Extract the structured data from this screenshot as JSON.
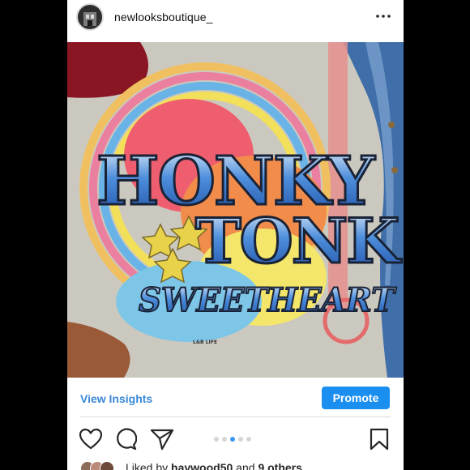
{
  "post": {
    "username": "newlooksboutique_",
    "more_icon": "more-options-icon",
    "image": {
      "headline_1": "HONKY",
      "headline_2": "TONK",
      "headline_3": "SWEETHEART",
      "brand_tag": "L&B LIFE"
    },
    "insights_label": "View Insights",
    "promote_label": "Promote",
    "carousel": {
      "count": 5,
      "active_index": 3
    },
    "actions": {
      "like_icon": "heart-icon",
      "comment_icon": "comment-icon",
      "share_icon": "send-icon",
      "save_icon": "bookmark-icon"
    },
    "liked_by": {
      "prefix": "Liked by ",
      "user": "haywood50",
      "middle": " and ",
      "others": "9 others"
    }
  },
  "colors": {
    "accent": "#3897f0",
    "promote_bg": "#1b8ff0",
    "insights_text": "#3b88d8"
  }
}
